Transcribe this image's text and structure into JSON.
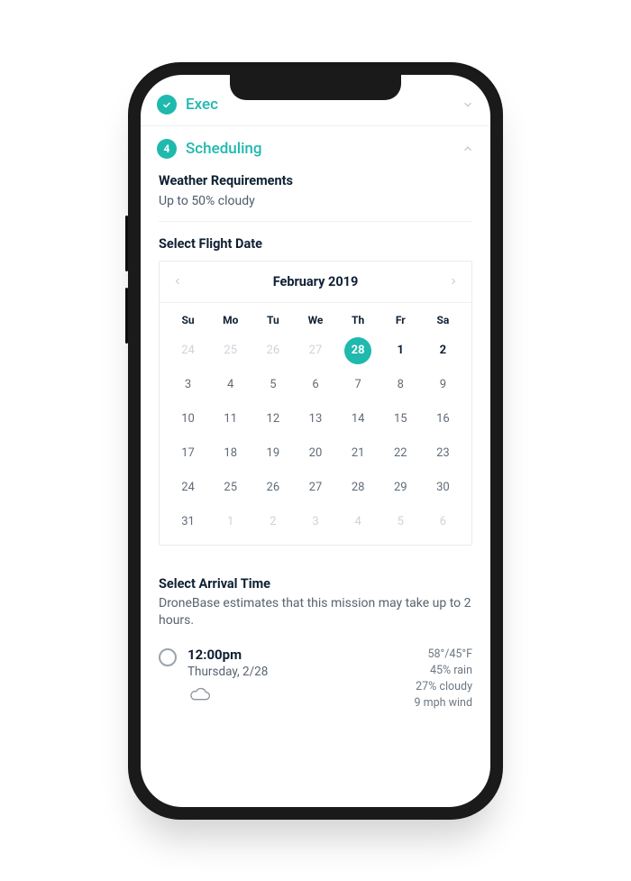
{
  "accordion": {
    "prev": {
      "title": "Exec",
      "icon": "check"
    },
    "current": {
      "num": "4",
      "title": "Scheduling"
    }
  },
  "weather": {
    "heading": "Weather Requirements",
    "text": "Up to 50% cloudy"
  },
  "flight": {
    "heading": "Select Flight Date"
  },
  "calendar": {
    "month": "February 2019",
    "dow": [
      "Su",
      "Mo",
      "Tu",
      "We",
      "Th",
      "Fr",
      "Sa"
    ],
    "cells": [
      {
        "n": "24",
        "cls": "muted"
      },
      {
        "n": "25",
        "cls": "muted"
      },
      {
        "n": "26",
        "cls": "muted"
      },
      {
        "n": "27",
        "cls": "muted"
      },
      {
        "n": "28",
        "cls": "sel"
      },
      {
        "n": "1",
        "cls": "bold"
      },
      {
        "n": "2",
        "cls": "bold"
      },
      {
        "n": "3"
      },
      {
        "n": "4"
      },
      {
        "n": "5"
      },
      {
        "n": "6"
      },
      {
        "n": "7"
      },
      {
        "n": "8"
      },
      {
        "n": "9"
      },
      {
        "n": "10"
      },
      {
        "n": "11"
      },
      {
        "n": "12"
      },
      {
        "n": "13"
      },
      {
        "n": "14"
      },
      {
        "n": "15"
      },
      {
        "n": "16"
      },
      {
        "n": "17"
      },
      {
        "n": "18"
      },
      {
        "n": "19"
      },
      {
        "n": "20"
      },
      {
        "n": "21"
      },
      {
        "n": "22"
      },
      {
        "n": "23"
      },
      {
        "n": "24"
      },
      {
        "n": "25"
      },
      {
        "n": "26"
      },
      {
        "n": "27"
      },
      {
        "n": "28"
      },
      {
        "n": "29"
      },
      {
        "n": "30"
      },
      {
        "n": "31"
      },
      {
        "n": "1",
        "cls": "muted"
      },
      {
        "n": "2",
        "cls": "muted"
      },
      {
        "n": "3",
        "cls": "muted"
      },
      {
        "n": "4",
        "cls": "muted"
      },
      {
        "n": "5",
        "cls": "muted"
      },
      {
        "n": "6",
        "cls": "muted"
      }
    ]
  },
  "arrival": {
    "heading": "Select Arrival Time",
    "blurb": "DroneBase estimates that this mission may take up to 2 hours."
  },
  "slot": {
    "time": "12:00pm",
    "date": "Thursday, 2/28",
    "w1": "58°/45°F",
    "w2": "45% rain",
    "w3": "27% cloudy",
    "w4": "9 mph wind"
  }
}
